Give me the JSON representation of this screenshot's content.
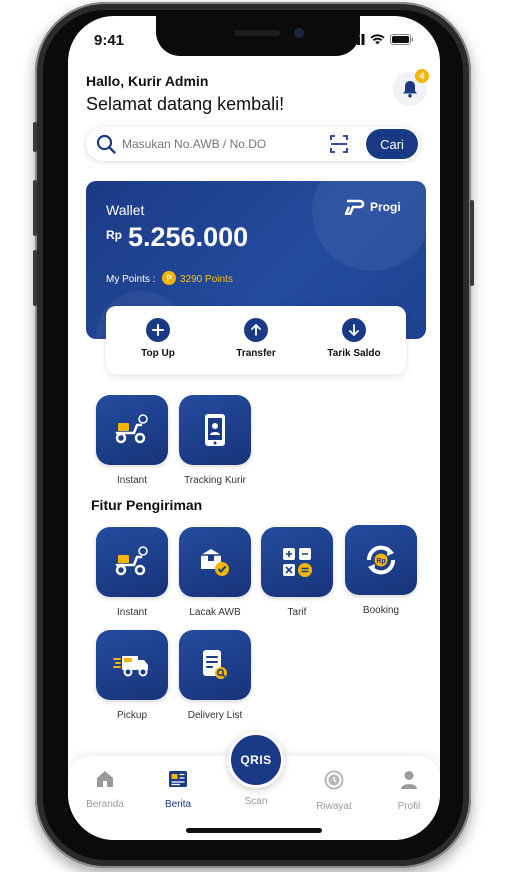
{
  "status_bar": {
    "time": "9:41"
  },
  "header": {
    "greeting": "Hallo, Kurir Admin",
    "subtitle": "Selamat datang kembali!",
    "notification_count": "4"
  },
  "search": {
    "placeholder": "Masukan No.AWB / No.DO",
    "button_label": "Cari"
  },
  "wallet": {
    "label": "Wallet",
    "currency": "Rp",
    "balance": "5.256.000",
    "points_label": "My Points :",
    "points_value": "3290 Points",
    "brand": "Progi"
  },
  "actions": [
    {
      "label": "Top Up",
      "icon": "plus-icon"
    },
    {
      "label": "Transfer",
      "icon": "arrow-up-icon"
    },
    {
      "label": "Tarik  Saldo",
      "icon": "arrow-down-icon"
    }
  ],
  "quick_menu": [
    {
      "label": "Instant",
      "icon": "scooter-icon"
    },
    {
      "label": "Tracking Kurir",
      "icon": "phone-courier-icon"
    }
  ],
  "features_title": "Fitur Pengiriman",
  "features": [
    {
      "label": "Instant",
      "icon": "scooter-icon"
    },
    {
      "label": "Lacak AWB",
      "icon": "box-check-icon"
    },
    {
      "label": "Tarif",
      "icon": "calculator-icon"
    },
    {
      "label": "Booking",
      "icon": "rp-cycle-icon"
    },
    {
      "label": "Pickup",
      "icon": "truck-icon"
    },
    {
      "label": "Delivery List",
      "icon": "document-search-icon"
    }
  ],
  "nav": {
    "items": [
      {
        "label": "Beranda",
        "icon": "home-icon"
      },
      {
        "label": "Berita",
        "icon": "news-icon"
      },
      {
        "label": "Scan",
        "icon": "qris-icon"
      },
      {
        "label": "Riwayat",
        "icon": "history-icon"
      },
      {
        "label": "Profil",
        "icon": "profile-icon"
      }
    ],
    "scan_logo": "QRIS",
    "active": "Berita"
  },
  "colors": {
    "primary": "#1b3a85",
    "accent": "#f5b400"
  }
}
